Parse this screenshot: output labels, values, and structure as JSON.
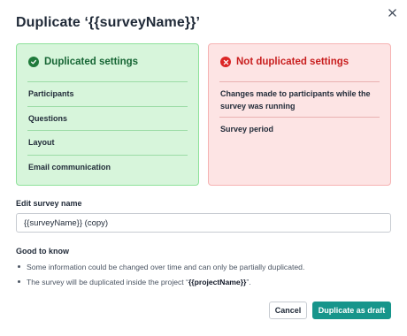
{
  "dialog": {
    "title": "Duplicate ‘{{surveyName}}’",
    "close_icon": "close-icon"
  },
  "duplicated": {
    "heading": "Duplicated settings",
    "icon": "check-circle-icon",
    "accent": "#166534",
    "items": [
      "Participants",
      "Questions",
      "Layout",
      "Email communication"
    ]
  },
  "not_duplicated": {
    "heading": "Not duplicated settings",
    "icon": "x-circle-icon",
    "accent": "#c81e1e",
    "items": [
      "Changes made to participants while the survey was running",
      "Survey period"
    ]
  },
  "edit": {
    "label": "Edit survey name",
    "value": "{{surveyName}} (copy)"
  },
  "good_to_know": {
    "label": "Good to know",
    "bullets": [
      {
        "text": "Some information could be changed over time and can only be partially duplicated."
      },
      {
        "prefix": "The survey will be duplicated inside the project “",
        "emphasis": "{{projectName}}",
        "suffix": "”."
      }
    ]
  },
  "actions": {
    "cancel_label": "Cancel",
    "primary_label": "Duplicate as draft",
    "primary_color": "#17958b"
  }
}
